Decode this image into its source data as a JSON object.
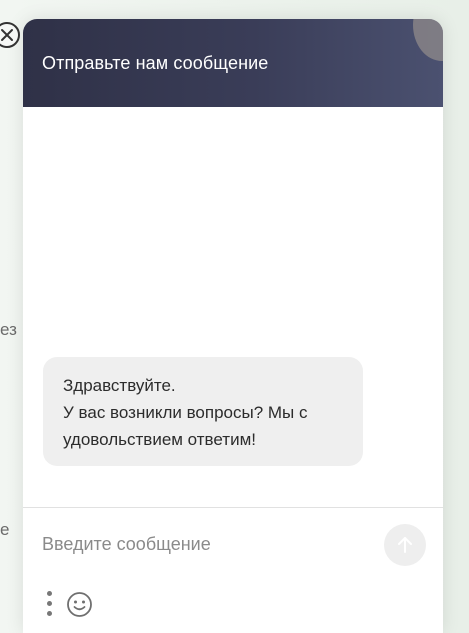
{
  "background": {
    "fragment_1": "ез",
    "fragment_2": "е"
  },
  "chat": {
    "header_title": "Отправьте нам сообщение",
    "messages": [
      {
        "lines": [
          "Здравствуйте.",
          "У вас возникли вопросы? Мы с",
          "удовольствием ответим!"
        ]
      }
    ],
    "input": {
      "placeholder": "Введите сообщение",
      "value": ""
    }
  },
  "icons": {
    "close": "close-icon",
    "send": "arrow-up-icon",
    "menu": "vertical-dots-icon",
    "emoji": "smiley-icon"
  },
  "colors": {
    "header_start": "#2f3147",
    "header_end": "#4b5170",
    "bubble_bg": "#efefef",
    "send_bg": "#eeeeee"
  }
}
